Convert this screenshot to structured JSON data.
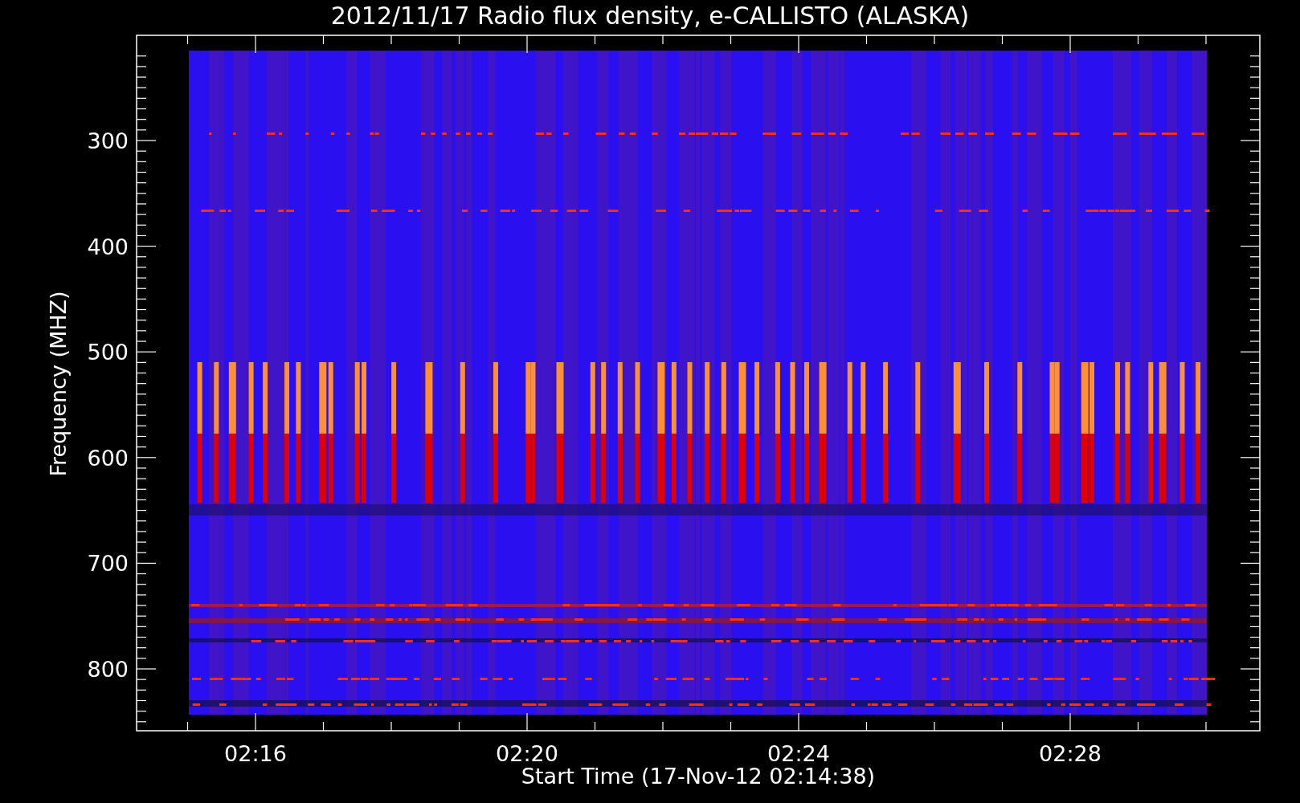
{
  "chart": {
    "title": "2012/11/17  Radio flux density, e-CALLISTO (ALASKA)",
    "ylabel": "Frequency (MHZ)",
    "yticks": [
      "300",
      "400",
      "500",
      "600",
      "700",
      "800"
    ],
    "xticks": [
      "02:16",
      "02:20",
      "02:24",
      "02:28"
    ],
    "xlabel": "Start Time (17-Nov-12 02:14:38)"
  }
}
